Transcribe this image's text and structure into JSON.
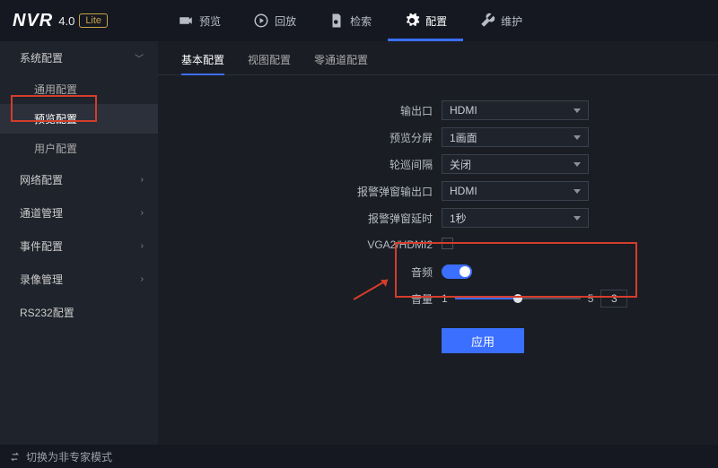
{
  "brand": {
    "name": "NVR",
    "version": "4.0",
    "lite": "Lite"
  },
  "topnav": [
    {
      "label": "预览"
    },
    {
      "label": "回放"
    },
    {
      "label": "检索"
    },
    {
      "label": "配置",
      "active": true
    },
    {
      "label": "维护"
    }
  ],
  "sidebar": {
    "system": {
      "label": "系统配置",
      "expanded": true,
      "items": [
        {
          "label": "通用配置"
        },
        {
          "label": "预览配置",
          "active": true
        },
        {
          "label": "用户配置"
        }
      ]
    },
    "others": [
      {
        "label": "网络配置"
      },
      {
        "label": "通道管理"
      },
      {
        "label": "事件配置"
      },
      {
        "label": "录像管理"
      },
      {
        "label": "RS232配置"
      }
    ]
  },
  "tabs": [
    {
      "label": "基本配置",
      "active": true
    },
    {
      "label": "视图配置"
    },
    {
      "label": "零通道配置"
    }
  ],
  "form": {
    "output_port": {
      "label": "输出口",
      "value": "HDMI"
    },
    "preview_split": {
      "label": "预览分屏",
      "value": "1画面"
    },
    "patrol_interval": {
      "label": "轮巡间隔",
      "value": "关闭"
    },
    "alarm_output": {
      "label": "报警弹窗输出口",
      "value": "HDMI"
    },
    "alarm_delay": {
      "label": "报警弹窗延时",
      "value": "1秒"
    },
    "vga2_hdmi2": {
      "label": "VGA2/HDMI2"
    },
    "audio": {
      "label": "音频",
      "value": true
    },
    "volume": {
      "label": "音量",
      "min": "1",
      "max": "5",
      "value": "3",
      "percent": 50
    }
  },
  "apply": "应用",
  "footer": "切换为非专家模式"
}
